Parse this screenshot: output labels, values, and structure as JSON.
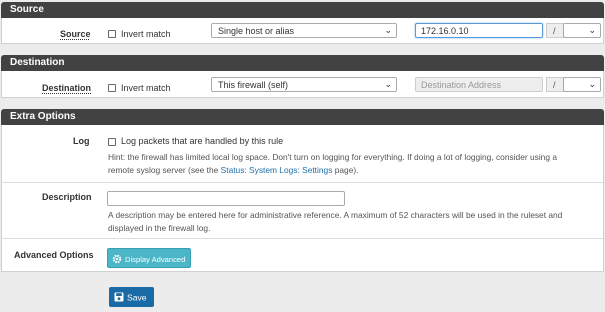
{
  "source": {
    "header": "Source",
    "label": "Source",
    "invert_label": "Invert match",
    "type_selected": "Single host or alias",
    "address_value": "172.16.0.10",
    "slash": "/"
  },
  "destination": {
    "header": "Destination",
    "label": "Destination",
    "invert_label": "Invert match",
    "type_selected": "This firewall (self)",
    "address_placeholder": "Destination Address",
    "slash": "/"
  },
  "extra": {
    "header": "Extra Options",
    "log_label": "Log",
    "log_checkbox_label": "Log packets that are handled by this rule",
    "log_hint_1": "Hint: the firewall has limited local log space. Don't turn on logging for everything. If doing a lot of logging, consider using a",
    "log_hint_2_pre": "remote syslog server (see the ",
    "log_hint_link": "Status: System Logs: Settings",
    "log_hint_2_post": " page).",
    "description_label": "Description",
    "description_value": "",
    "description_hint_1": "A description may be entered here for administrative reference. A maximum of 52 characters will be used in the ruleset and",
    "description_hint_2": "displayed in the firewall log.",
    "advanced_label": "Advanced Options",
    "advanced_button": "Display Advanced"
  },
  "save_button": "Save",
  "colors": {
    "header_bg": "#424242",
    "advanced_btn": "#4ab6c7",
    "save_btn": "#1a6aa6",
    "link": "#1e6fa8"
  }
}
